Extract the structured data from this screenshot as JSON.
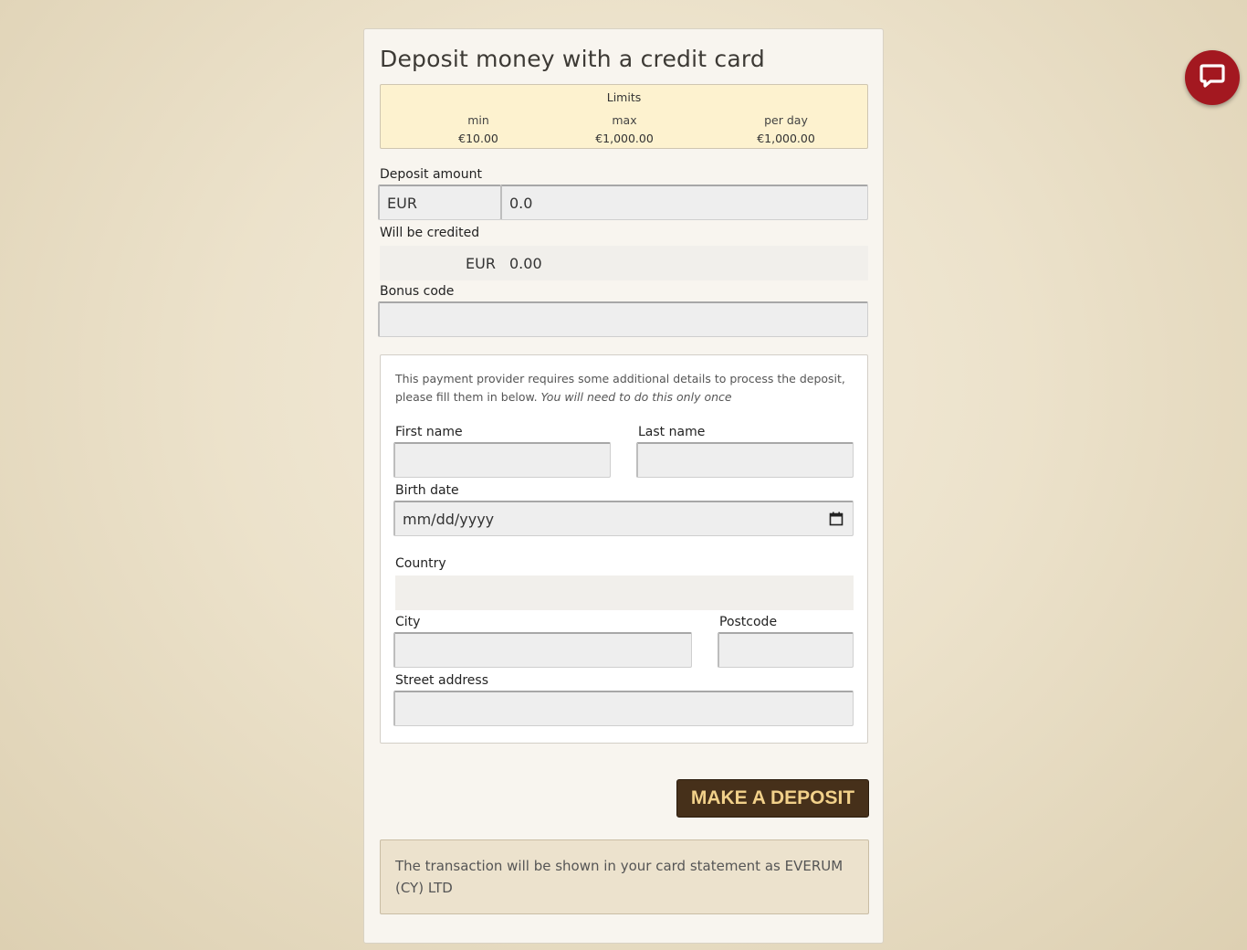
{
  "title": "Deposit money with a credit card",
  "limits": {
    "heading": "Limits",
    "items": [
      {
        "label": "min",
        "value": "€10.00"
      },
      {
        "label": "max",
        "value": "€1,000.00"
      },
      {
        "label": "per day",
        "value": "€1,000.00"
      }
    ]
  },
  "deposit": {
    "label": "Deposit amount",
    "currency": "EUR",
    "amount": "0.0"
  },
  "credited": {
    "label": "Will be credited",
    "currency": "EUR",
    "amount": "0.00"
  },
  "bonus": {
    "label": "Bonus code",
    "value": ""
  },
  "details": {
    "note": "This payment provider requires some additional details to process the deposit, please fill them in below.",
    "note_italic": "You will need to do this only once",
    "first_name_label": "First name",
    "last_name_label": "Last name",
    "birth_date_label": "Birth date",
    "birth_date_placeholder": "mm/dd/yyyy",
    "country_label": "Country",
    "city_label": "City",
    "postcode_label": "Postcode",
    "street_label": "Street address"
  },
  "submit_label": "MAKE A DEPOSIT",
  "statement": "The transaction will be shown in your card statement as EVERUM (CY) LTD",
  "icons": {
    "calendar": "calendar-icon",
    "chat": "chat-icon"
  },
  "colors": {
    "button_bg": "#46301a",
    "button_text": "#f2d18a",
    "chat_bg": "#a31820",
    "limits_bg": "#fdf2cf"
  }
}
